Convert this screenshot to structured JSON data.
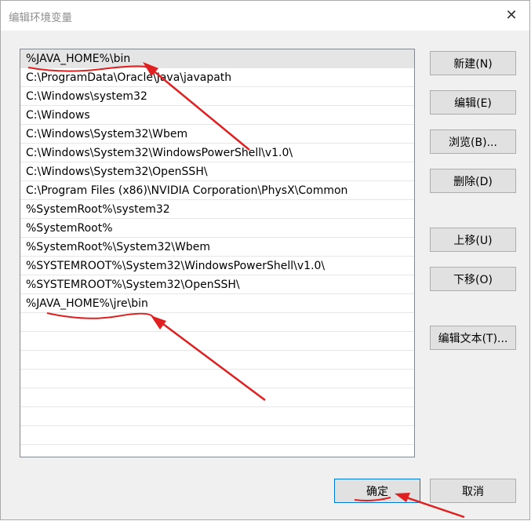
{
  "window": {
    "title": "编辑环境变量",
    "close_label": "✕"
  },
  "path_list": [
    "%JAVA_HOME%\\bin",
    "C:\\ProgramData\\Oracle\\Java\\javapath",
    "C:\\Windows\\system32",
    "C:\\Windows",
    "C:\\Windows\\System32\\Wbem",
    "C:\\Windows\\System32\\WindowsPowerShell\\v1.0\\",
    "C:\\Windows\\System32\\OpenSSH\\",
    "C:\\Program Files (x86)\\NVIDIA Corporation\\PhysX\\Common",
    "%SystemRoot%\\system32",
    "%SystemRoot%",
    "%SystemRoot%\\System32\\Wbem",
    "%SYSTEMROOT%\\System32\\WindowsPowerShell\\v1.0\\",
    "%SYSTEMROOT%\\System32\\OpenSSH\\",
    "%JAVA_HOME%\\jre\\bin",
    "",
    "",
    "",
    "",
    "",
    "",
    ""
  ],
  "buttons": {
    "new": "新建(N)",
    "edit": "编辑(E)",
    "browse": "浏览(B)...",
    "delete": "删除(D)",
    "move_up": "上移(U)",
    "move_down": "下移(O)",
    "edit_text": "编辑文本(T)...",
    "ok": "确定",
    "cancel": "取消"
  },
  "colors": {
    "annotation": "#e02020",
    "selected_row": "#e5e5e5",
    "dialog_bg": "#f0f0f0"
  }
}
